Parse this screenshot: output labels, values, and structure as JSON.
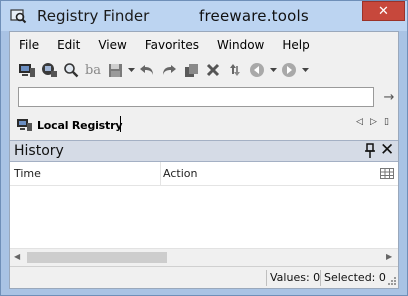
{
  "window": {
    "title": "Registry Finder",
    "watermark": "freeware.tools",
    "close_glyph": "✕"
  },
  "menu": [
    "File",
    "Edit",
    "View",
    "Favorites",
    "Window",
    "Help"
  ],
  "toolbar": {
    "text_search_glyph": "ba",
    "go_arrow": "→"
  },
  "address": {
    "value": "",
    "placeholder": ""
  },
  "tabs": {
    "active_label": "Local Registry",
    "nav_prev": "◁",
    "nav_next": "▷",
    "nav_close": "▯"
  },
  "history": {
    "title": "History",
    "columns": [
      "Time",
      "Action"
    ]
  },
  "scrollbar": {
    "left_arrow": "◀",
    "right_arrow": "▶"
  },
  "status": {
    "values": "Values: 0",
    "selected": "Selected: 0"
  },
  "colors": {
    "title_bar": "#bcd4f1",
    "close": "#c7483c",
    "panel_header": "#d5dbe6"
  }
}
